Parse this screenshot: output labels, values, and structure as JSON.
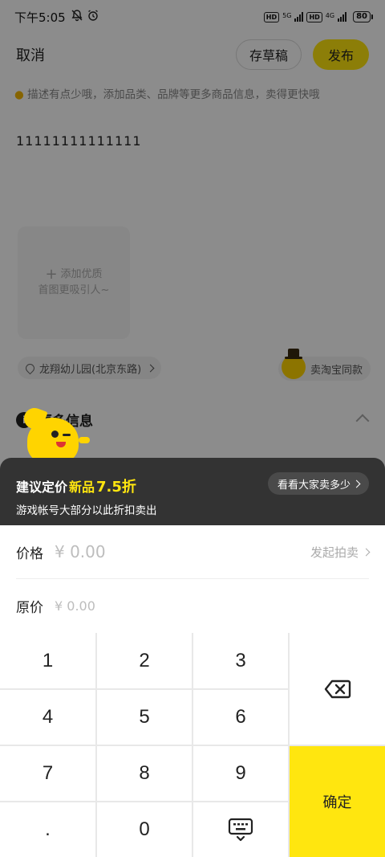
{
  "status_bar": {
    "time": "下午5:05",
    "mute_icon": "bell-off-icon",
    "alarm_icon": "alarm-icon",
    "hd": "HD",
    "net1": "5G",
    "net2": "4G",
    "battery": "80"
  },
  "header": {
    "cancel_label": "取消",
    "draft_label": "存草稿",
    "publish_label": "发布"
  },
  "tip": {
    "icon": "lightbulb-icon",
    "text": "描述有点少哦，添加品类、品牌等更多商品信息，卖得更快哦"
  },
  "description": "11111111111111",
  "photo": {
    "line1": "添加优质",
    "line2": "首图更吸引人~"
  },
  "location": {
    "text": "龙翔幼儿园(北京东路)"
  },
  "same_style": {
    "text": "卖淘宝同款"
  },
  "more_info": {
    "title": "更多信息"
  },
  "suggest": {
    "prefix": "建议定价",
    "highlight_word": "新品",
    "highlight_value": "7.5折",
    "subtitle": "游戏帐号大部分以此折扣卖出",
    "see_label": "看看大家卖多少"
  },
  "form": {
    "price_label": "价格",
    "price_placeholder": "¥ 0.00",
    "auction_label": "发起拍卖",
    "orig_label": "原价",
    "orig_placeholder": "¥ 0.00"
  },
  "keypad": {
    "keys": [
      "1",
      "2",
      "3",
      "4",
      "5",
      "6",
      "7",
      "8",
      "9",
      ".",
      "0"
    ],
    "delete_icon": "backspace-icon",
    "keyboard_icon": "keyboard-hide-icon",
    "confirm_label": "确定",
    "accent": "#ffe60f"
  }
}
